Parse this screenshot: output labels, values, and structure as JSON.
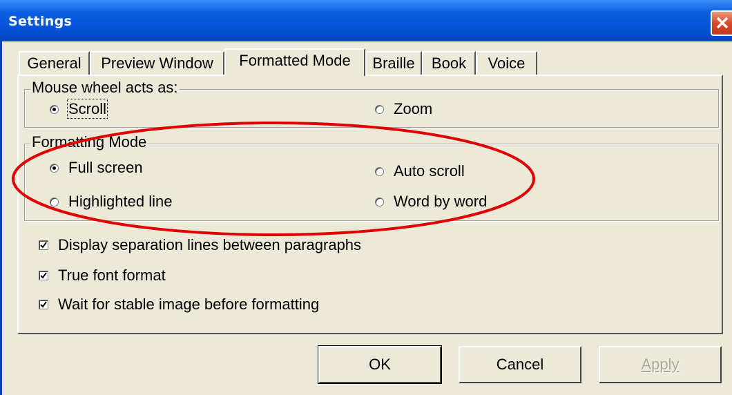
{
  "window": {
    "title": "Settings"
  },
  "tabs": [
    {
      "label": "General"
    },
    {
      "label": "Preview Window"
    },
    {
      "label": "Formatted Mode",
      "selected": true
    },
    {
      "label": "Braille"
    },
    {
      "label": "Book"
    },
    {
      "label": "Voice"
    }
  ],
  "mouse_wheel": {
    "legend": "Mouse wheel acts as:",
    "options": [
      {
        "label": "Scroll",
        "checked": true
      },
      {
        "label": "Zoom",
        "checked": false
      }
    ]
  },
  "formatting_mode": {
    "legend": "Formatting Mode",
    "options": [
      {
        "label": "Full screen",
        "checked": true
      },
      {
        "label": "Auto scroll",
        "checked": false
      },
      {
        "label": "Highlighted line",
        "checked": false
      },
      {
        "label": "Word by word",
        "checked": false
      }
    ]
  },
  "checkboxes": [
    {
      "label": "Display separation lines between paragraphs",
      "checked": true
    },
    {
      "label": "True font format",
      "checked": true
    },
    {
      "label": "Wait for stable image before formatting",
      "checked": true
    }
  ],
  "buttons": {
    "ok": "OK",
    "cancel": "Cancel",
    "apply": "Apply"
  },
  "colors": {
    "annotation_ellipse": "#e00000",
    "titlebar": "#0a5fe0",
    "dialog_face": "#ece9d8"
  }
}
